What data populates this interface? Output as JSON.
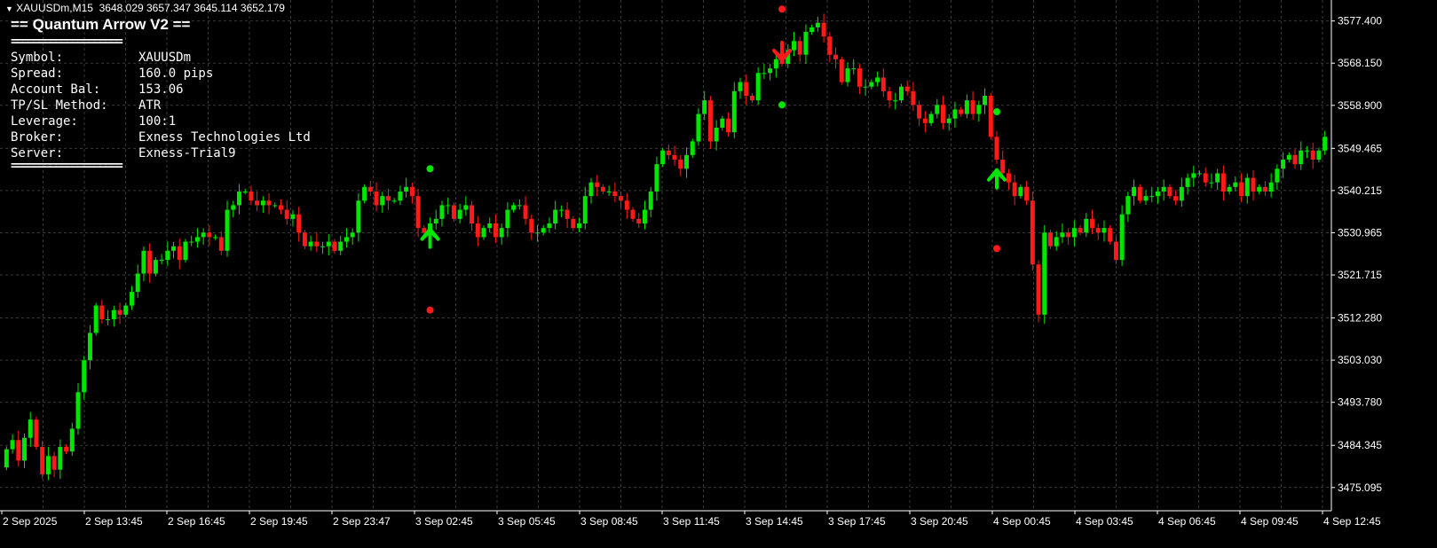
{
  "header": {
    "symbol_tf": "XAUUSDm,M15",
    "ohlc": "3648.029 3657.347 3645.114 3652.179"
  },
  "panel": {
    "title": "== Quantum Arrow V2 ==",
    "separator": "====================",
    "rows": [
      {
        "label": "Symbol:",
        "value": "XAUUSDm"
      },
      {
        "label": "Spread:",
        "value": "160.0 pips"
      },
      {
        "label": "Account Bal:",
        "value": "153.06"
      },
      {
        "label": "TP/SL Method:",
        "value": "ATR"
      },
      {
        "label": "Leverage:",
        "value": "100:1"
      },
      {
        "label": "Broker:",
        "value": "Exness Technologies Ltd"
      },
      {
        "label": "Server:",
        "value": "Exness-Trial9"
      }
    ]
  },
  "colors": {
    "background": "#000000",
    "bull": "#00e600",
    "bear": "#ff1a1a",
    "grid": "#3a3a3a",
    "text": "#ffffff"
  },
  "chart_data": {
    "type": "candlestick",
    "title": "",
    "grid": true,
    "ylim": [
      3470.0,
      3582.0
    ],
    "y_ticks": [
      3577.4,
      3568.15,
      3558.9,
      3549.465,
      3540.215,
      3530.965,
      3521.715,
      3512.28,
      3503.03,
      3493.78,
      3484.345,
      3475.095
    ],
    "y_tick_labels": [
      "3577.400",
      "3568.150",
      "3558.900",
      "3549.465",
      "3540.215",
      "3530.965",
      "3521.715",
      "3512.280",
      "3503.030",
      "3493.780",
      "3484.345",
      "3475.095"
    ],
    "x_tick_labels": [
      "2 Sep 2025",
      "2 Sep 13:45",
      "2 Sep 16:45",
      "2 Sep 19:45",
      "2 Sep 23:47",
      "3 Sep 02:45",
      "3 Sep 05:45",
      "3 Sep 08:45",
      "3 Sep 11:45",
      "3 Sep 14:45",
      "3 Sep 17:45",
      "3 Sep 20:45",
      "4 Sep 00:45",
      "4 Sep 03:45",
      "4 Sep 06:45",
      "4 Sep 09:45",
      "4 Sep 12:45"
    ],
    "bar_count": 216,
    "close": [
      3483.5,
      3485.5,
      3481.0,
      3486.0,
      3490.0,
      3484.0,
      3478.0,
      3482.0,
      3479.0,
      3484.0,
      3483.0,
      3488.0,
      3496.0,
      3503.0,
      3509.0,
      3515.0,
      3512.0,
      3512.0,
      3514.0,
      3513.0,
      3515.0,
      3518.0,
      3522.0,
      3527.0,
      3522.0,
      3525.0,
      3525.0,
      3527.0,
      3528.0,
      3525.0,
      3529.0,
      3529.0,
      3530.0,
      3531.0,
      3530.0,
      3530.0,
      3527.0,
      3536.0,
      3537.0,
      3540.0,
      3540.0,
      3538.0,
      3537.0,
      3538.0,
      3537.0,
      3537.0,
      3536.0,
      3534.0,
      3535.0,
      3531.0,
      3528.0,
      3529.0,
      3528.0,
      3528.0,
      3529.0,
      3527.0,
      3529.0,
      3530.0,
      3531.0,
      3538.0,
      3541.0,
      3540.0,
      3537.0,
      3539.0,
      3538.0,
      3538.0,
      3540.0,
      3541.0,
      3539.0,
      3532.0,
      3531.0,
      3533.0,
      3534.0,
      3537.0,
      3537.0,
      3534.0,
      3536.0,
      3537.0,
      3533.0,
      3530.0,
      3532.0,
      3533.0,
      3530.0,
      3532.0,
      3536.0,
      3537.0,
      3537.0,
      3534.0,
      3531.0,
      3531.0,
      3532.0,
      3533.0,
      3536.0,
      3536.0,
      3534.0,
      3532.0,
      3533.0,
      3539.0,
      3542.0,
      3541.0,
      3540.0,
      3540.0,
      3539.0,
      3538.0,
      3536.0,
      3534.0,
      3533.0,
      3536.0,
      3540.0,
      3546.0,
      3549.0,
      3548.0,
      3547.0,
      3545.0,
      3548.0,
      3551.0,
      3557.0,
      3560.0,
      3551.0,
      3554.0,
      3556.0,
      3553.0,
      3562.0,
      3564.0,
      3561.0,
      3560.0,
      3566.0,
      3566.0,
      3567.0,
      3569.0,
      3568.0,
      3571.0,
      3573.0,
      3570.0,
      3575.0,
      3576.0,
      3577.0,
      3574.0,
      3570.0,
      3569.0,
      3564.0,
      3567.0,
      3567.0,
      3563.0,
      3563.0,
      3564.0,
      3565.0,
      3562.0,
      3560.0,
      3560.0,
      3563.0,
      3562.0,
      3559.0,
      3556.0,
      3555.0,
      3557.0,
      3559.0,
      3555.0,
      3556.0,
      3558.0,
      3557.0,
      3560.0,
      3557.0,
      3559.0,
      3561.0,
      3552.0,
      3547.0,
      3544.0,
      3542.0,
      3539.0,
      3541.0,
      3538.0,
      3524.0,
      3513.0,
      3531.0,
      3528.0,
      3530.0,
      3531.0,
      3530.0,
      3532.0,
      3531.0,
      3534.0,
      3532.0,
      3531.0,
      3532.0,
      3529.0,
      3525.0,
      3535.0,
      3539.0,
      3541.0,
      3538.0,
      3539.0,
      3539.0,
      3540.0,
      3541.0,
      3539.0,
      3538.0,
      3541.0,
      3543.0,
      3544.0,
      3544.0,
      3542.0,
      3542.0,
      3544.0,
      3540.0,
      3541.0,
      3542.0,
      3539.0,
      3543.0,
      3540.0,
      3541.0,
      3540.0,
      3542.0,
      3545.0,
      3547.0,
      3548.0,
      3546.0,
      3549.0,
      3549.0,
      3547.0,
      3549.0,
      3552.0
    ],
    "arrows": [
      {
        "direction": "up",
        "bar": 71,
        "price": 3529.0,
        "tp": 3545.0,
        "sl": 3514.0
      },
      {
        "direction": "down",
        "bar": 130,
        "price": 3571.5,
        "tp": 3559.0,
        "sl": 3580.0
      },
      {
        "direction": "up",
        "bar": 166,
        "price": 3542.0,
        "tp": 3557.5,
        "sl": 3527.5
      }
    ]
  }
}
